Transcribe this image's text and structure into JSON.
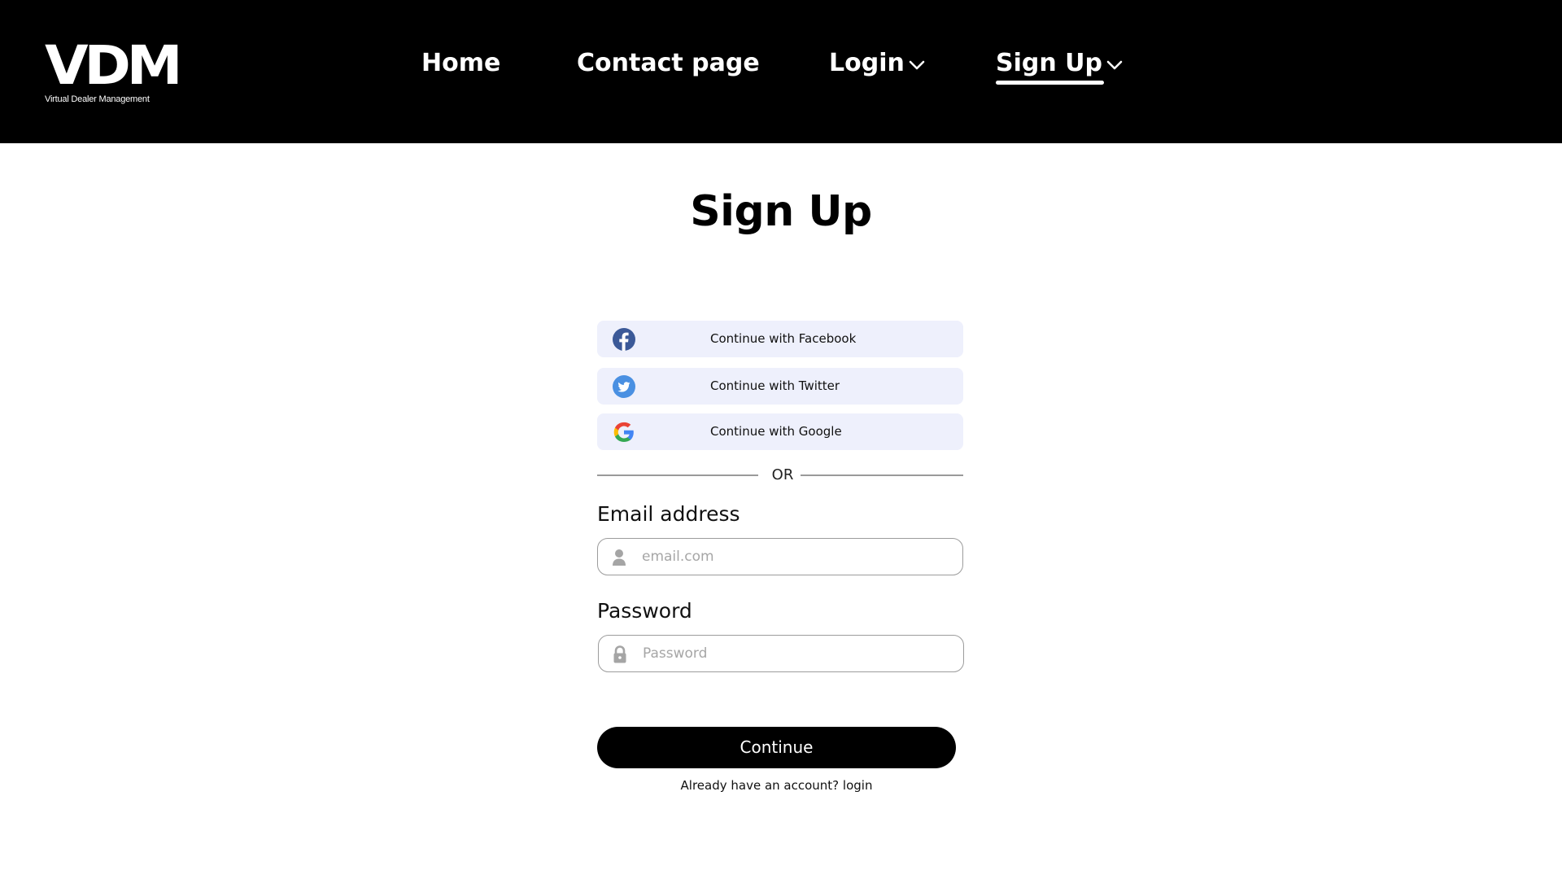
{
  "header": {
    "logo": {
      "mark": "VDM",
      "subtitle": "Virtual Dealer Management"
    },
    "nav": {
      "home": "Home",
      "contact": "Contact page",
      "login": "Login",
      "signup": "Sign Up"
    },
    "active_nav": "signup",
    "icons": {
      "dropdown": "chevron-down-icon"
    }
  },
  "main": {
    "title": "Sign Up",
    "social": {
      "facebook": {
        "label": "Continue with Facebook",
        "icon": "facebook-icon",
        "color": "#3b5998"
      },
      "twitter": {
        "label": "Continue with Twitter",
        "icon": "twitter-icon",
        "color": "#4a90e2"
      },
      "google": {
        "label": "Continue with Google",
        "icon": "google-icon"
      }
    },
    "divider": "OR",
    "email": {
      "label": "Email address",
      "placeholder": "email.com",
      "icon": "user-icon"
    },
    "password": {
      "label": "Password",
      "placeholder": "Password",
      "icon": "lock-icon"
    },
    "continue_label": "Continue",
    "login_prompt": "Already have an account?",
    "login_link": "login"
  },
  "colors": {
    "header_bg": "#000000",
    "social_button_bg": "#eef0fc",
    "primary_button_bg": "#000000"
  }
}
